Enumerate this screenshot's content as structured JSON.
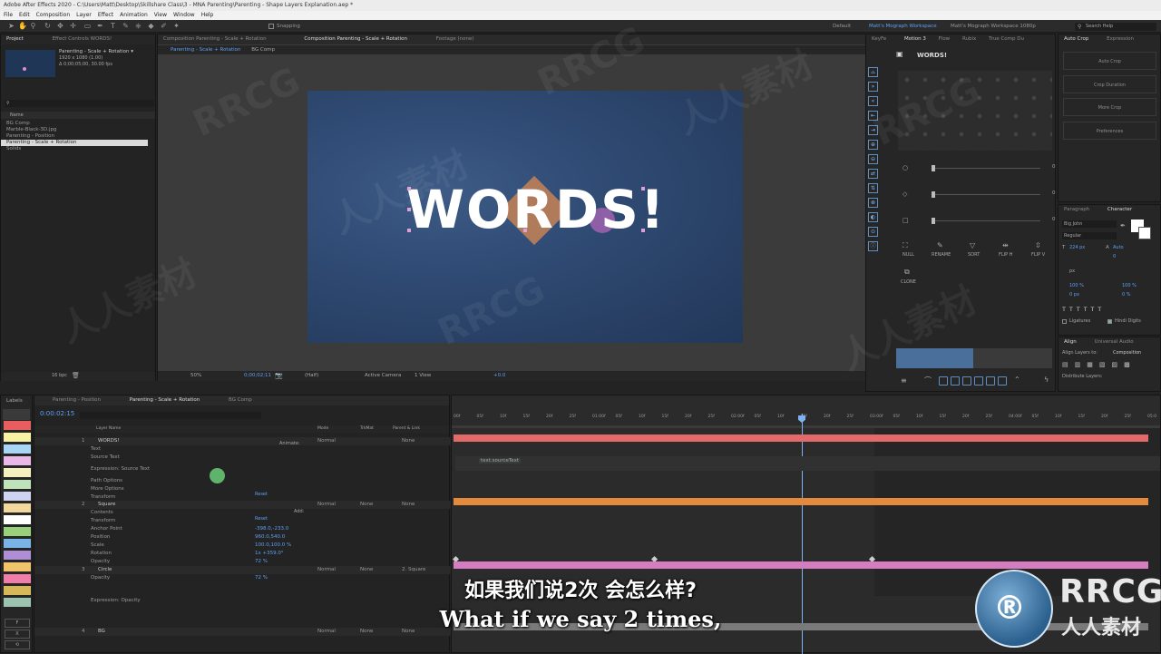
{
  "app": {
    "title": "Adobe After Effects 2020 - C:\\Users\\Matt\\Desktop\\Skillshare Class\\3 - MNA Parenting\\Parenting - Shape Layers Explanation.aep *",
    "menu": [
      "File",
      "Edit",
      "Composition",
      "Layer",
      "Effect",
      "Animation",
      "View",
      "Window",
      "Help"
    ],
    "snapping_label": "Snapping",
    "workspaces": [
      "Default",
      "Matt's Mograph Workspace",
      "Matt's Mograph Workspace 1080p"
    ],
    "search_placeholder": "Search Help"
  },
  "project": {
    "tabs": [
      "Project",
      "Effect Controls WORDS!"
    ],
    "comp_name": "Parenting - Scale + Rotation ▾",
    "comp_info": "1920 x 1080 (1.00)",
    "comp_duration": "Δ 0;00;05;00, 30.00 fps",
    "name_header": "Name",
    "items": [
      "BG Comp",
      "Marble-Black-3D.jpg",
      "Parenting - Position",
      "Parenting - Scale + Rotation",
      "Solids"
    ],
    "bpc": "16 bpc"
  },
  "viewer": {
    "tabs": [
      "Composition Parenting - Scale + Rotation",
      "Composition Parenting - Scale + Rotation",
      "Footage (none)"
    ],
    "breadcrumbs": [
      "Parenting - Scale + Rotation",
      "BG Comp"
    ],
    "zoom": "50%",
    "timecode": "0;00;02;11",
    "resolution": "(Half)",
    "camera": "Active Camera",
    "views": "1 View",
    "exposure": "+0.0",
    "canvas_text": "WORDS!"
  },
  "motion": {
    "tabs": [
      "KeyFe",
      "Motion 3",
      "Flow",
      "Rubix",
      "True Comp Du"
    ],
    "layer_label": "WORDS!",
    "slider_values": [
      "0",
      "0",
      "0"
    ],
    "buttons": [
      "NULL",
      "RENAME",
      "SORT",
      "FLIP H",
      "FLIP V",
      "CLONE"
    ]
  },
  "autocrop": {
    "tabs": [
      "Auto Crop",
      "Expression"
    ],
    "buttons": [
      "Auto Crop",
      "Crop Duration",
      "More Crop",
      "Preferences"
    ]
  },
  "character": {
    "tabs": [
      "Paragraph",
      "Character"
    ],
    "font": "Big John",
    "style": "Regular",
    "size": "224 px",
    "leading": "Auto",
    "tracking": "0",
    "units": "px",
    "vscale": "100 %",
    "hscale": "100 %",
    "baseline": "0 px",
    "tsume": "0 %",
    "ligatures": "Ligatures",
    "hindi": "Hindi Digits"
  },
  "align": {
    "tabs": [
      "Align",
      "Universal Audio"
    ],
    "align_to_label": "Align Layers to:",
    "align_to": "Composition",
    "distribute": "Distribute Layers:"
  },
  "timeline": {
    "labels_title": "Labels",
    "label_colors": [
      "#e85d5d",
      "#f7f3a3",
      "#a9d6f5",
      "#e9b8e9",
      "#f5f0c0",
      "#bfe3b8",
      "#cfd3f2",
      "#f2d89c",
      "#ffffff",
      "#9ad07a",
      "#7ab3e6",
      "#b08ed6",
      "#f0c46a",
      "#f07ea8",
      "#d6b85a",
      "#9cc3b0"
    ],
    "tabs": [
      "Parenting - Position",
      "Parenting - Scale + Rotation",
      "BG Comp"
    ],
    "timecode": "0:00:02:15",
    "col_layer_name": "Layer Name",
    "col_mode": "Mode",
    "col_trkmat": "TrkMat",
    "col_parent": "Parent & Link",
    "rows": [
      {
        "num": "1",
        "name": "WORDS!",
        "mode": "Normal",
        "parent": "None"
      },
      {
        "label": "Text"
      },
      {
        "label": "Source Text"
      },
      {
        "label": "Expression: Source Text"
      },
      {
        "label": "Path Options"
      },
      {
        "label": "More Options"
      },
      {
        "label": "Transform"
      },
      {
        "num": "2",
        "name": "Square",
        "mode": "Normal",
        "trkmat": "None",
        "parent": "None"
      },
      {
        "label": "Contents"
      },
      {
        "label": "Transform"
      },
      {
        "label": "Anchor Point",
        "value": "-398.0,-233.0"
      },
      {
        "label": "Position",
        "value": "960.0,540.0"
      },
      {
        "label": "Scale",
        "value": "100.0,100.0 %"
      },
      {
        "label": "Rotation",
        "value": "1x +359.0°"
      },
      {
        "label": "Opacity",
        "value": "72 %"
      },
      {
        "num": "3",
        "name": "Circle",
        "mode": "Normal",
        "trkmat": "None",
        "parent": "2. Square"
      },
      {
        "label": "Opacity",
        "value": "72 %"
      },
      {
        "label": "Expression: Opacity"
      },
      {
        "num": "4",
        "name": "BG",
        "mode": "Normal",
        "trkmat": "None",
        "parent": "None"
      }
    ],
    "animate_label": "Animate:",
    "add_label": "Add:",
    "reset_label": "Reset",
    "expression_text": "text.sourceText",
    "ruler": [
      "00f",
      "05f",
      "10f",
      "15f",
      "20f",
      "25f",
      "01:00f",
      "05f",
      "10f",
      "15f",
      "20f",
      "25f",
      "02:00f",
      "05f",
      "10f",
      "15f",
      "20f",
      "25f",
      "03:00f",
      "05f",
      "10f",
      "15f",
      "20f",
      "25f",
      "04:00f",
      "05f",
      "10f",
      "15f",
      "20f",
      "25f",
      "05:0"
    ]
  },
  "subtitles": {
    "cn": "如果我们说2次 会怎么样?",
    "en": "What if we say 2 times,"
  },
  "watermark": {
    "brand": "RRCG",
    "brand_cn": "人人素材",
    "tiles": [
      "RRCG",
      "人人素材",
      "RRCG",
      "人人素材",
      "RRCG",
      "人人素材",
      "RRCG",
      "人人素材"
    ]
  }
}
